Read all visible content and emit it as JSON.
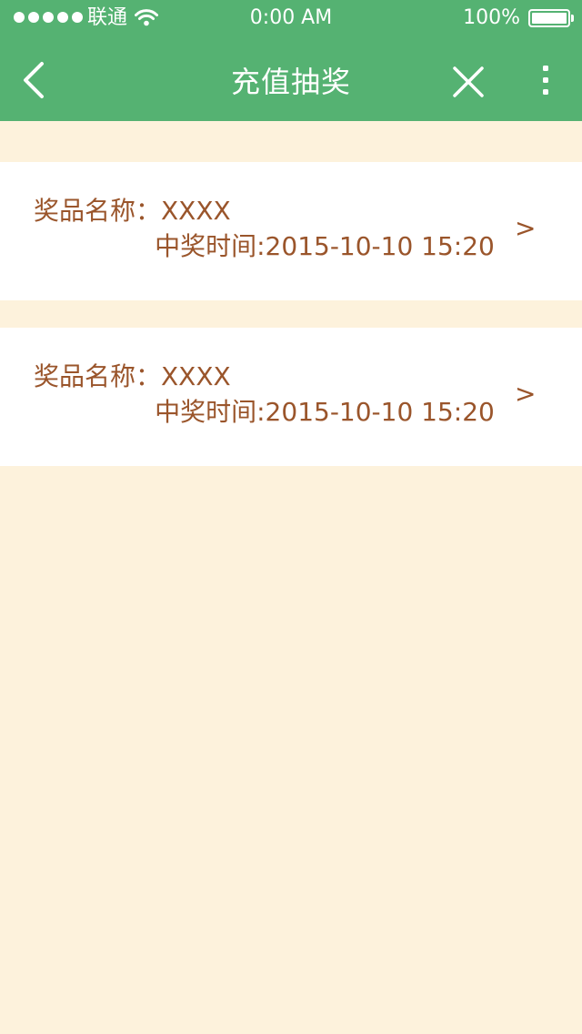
{
  "status_bar": {
    "carrier": "联通",
    "time": "0:00 AM",
    "battery_percent": "100%",
    "signal_strength": 5
  },
  "nav_bar": {
    "title": "充值抽奖",
    "back_icon": "chevron-left-icon",
    "close_icon": "close-icon",
    "more_icon": "more-vertical-icon"
  },
  "records": [
    {
      "prize_name": "奖品名称：XXXX",
      "win_time": "中奖时间:2015-10-10 15:20",
      "arrow": ">"
    },
    {
      "prize_name": "奖品名称：XXXX",
      "win_time": "中奖时间:2015-10-10 15:20",
      "arrow": ">"
    }
  ],
  "colors": {
    "nav_green": "#55b272",
    "page_background": "#fdf2dc",
    "card_background": "#ffffff",
    "record_text": "#9a552b",
    "header_text": "#ffffff"
  }
}
